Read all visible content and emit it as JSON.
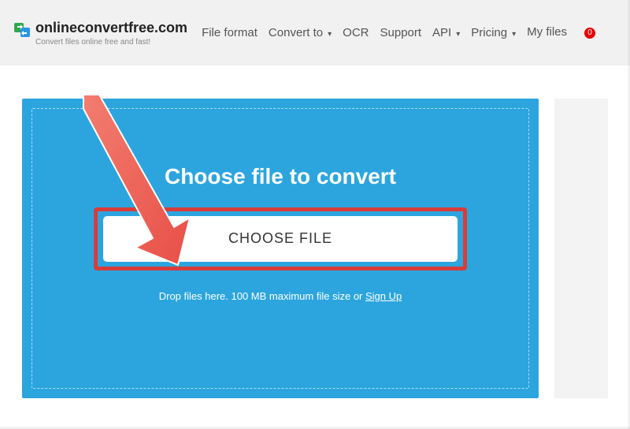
{
  "header": {
    "logo_text": "onlineconvertfree.com",
    "tagline": "Convert files online free and fast!",
    "nav": {
      "file_format": "File format",
      "convert_to": "Convert to",
      "ocr": "OCR",
      "support": "Support",
      "api": "API",
      "pricing": "Pricing",
      "my_files": "My files"
    },
    "badge_count": "0"
  },
  "upload": {
    "heading": "Choose file to convert",
    "button_label": "CHOOSE FILE",
    "drop_prefix": "Drop files here. 100 MB maximum file size or ",
    "signup": "Sign Up"
  }
}
